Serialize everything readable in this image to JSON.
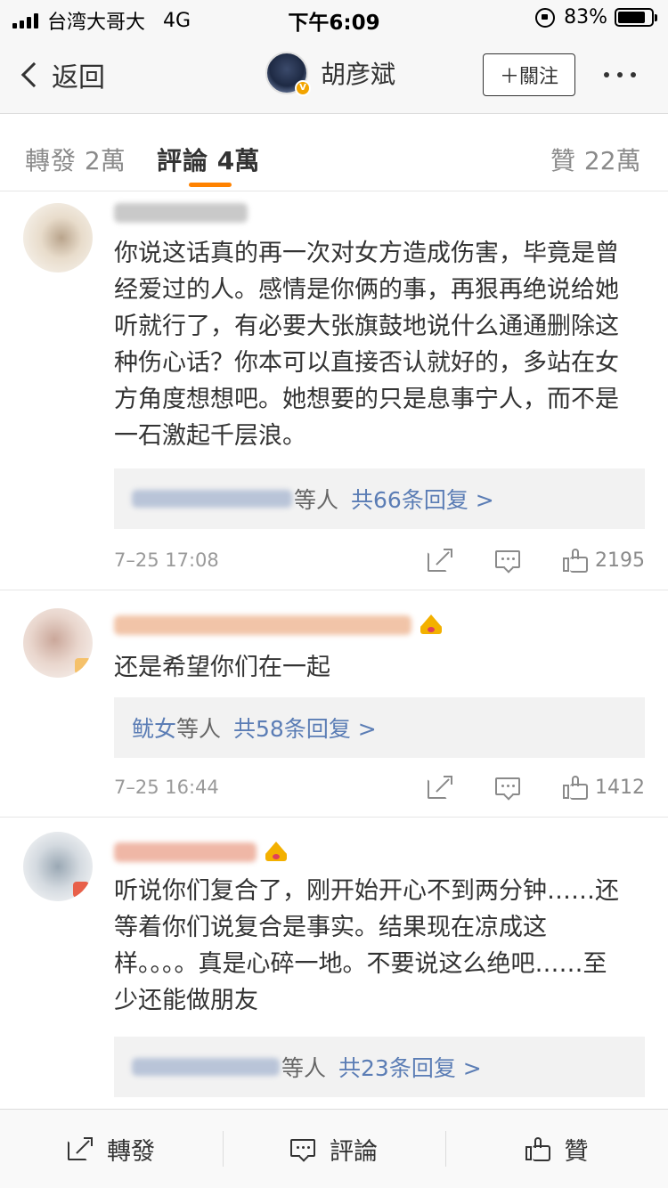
{
  "status_bar": {
    "carrier": "台湾大哥大",
    "network": "4G",
    "time": "下午6:09",
    "battery_percent": "83%",
    "battery_level": 0.83
  },
  "nav": {
    "back_label": "返回",
    "user_name": "胡彦斌",
    "follow_label": "＋關注"
  },
  "tabs": {
    "repost": {
      "label": "轉發",
      "count": "2萬"
    },
    "comments": {
      "label": "評論",
      "count": "4萬"
    },
    "likes": {
      "label": "贊",
      "count": "22萬"
    }
  },
  "comments": [
    {
      "text": "你说这话真的再一次对女方造成伤害，毕竟是曾经爱过的人。感情是你俩的事，再狠再绝说给她听就行了，有必要大张旗鼓地说什么通通删除这种伤心话？你本可以直接否认就好的，多站在女方角度想想吧。她想要的只是息事宁人，而不是一石激起千层浪。",
      "replies_etc": "等人",
      "replies_total": "共66条回复 >",
      "time": "7–25 17:08",
      "likes": "2195"
    },
    {
      "text": "还是希望你们在一起",
      "replies_names": "鱿女",
      "replies_etc": "等人",
      "replies_total": "共58条回复 >",
      "time": "7–25 16:44",
      "likes": "1412"
    },
    {
      "text": "听说你们复合了，刚开始开心不到两分钟……还等着你们说复合是事实。结果现在凉成这样。。。。真是心碎一地。不要说这么绝吧……至少还能做朋友",
      "replies_etc": "等人",
      "replies_total": "共23条回复 >"
    }
  ],
  "toolbar": {
    "repost": "轉發",
    "comment": "評論",
    "like": "贊"
  },
  "colors": {
    "accent": "#ff8200",
    "link": "#5b7db5",
    "muted": "#8a8a8a",
    "crown": "#f3b000"
  }
}
